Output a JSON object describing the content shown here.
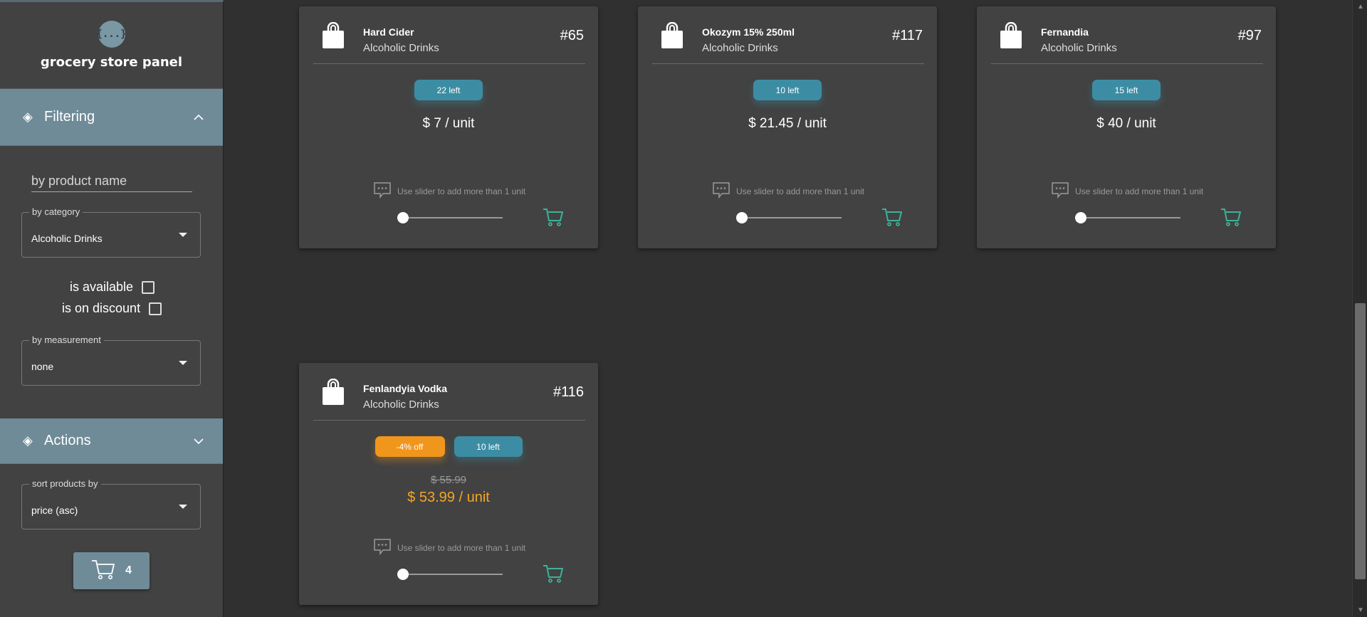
{
  "app": {
    "logo_glyph": "{...}",
    "title": "grocery store panel"
  },
  "sidebar": {
    "filtering": {
      "label": "Filtering",
      "expanded": true
    },
    "search": {
      "placeholder": "by product name",
      "value": ""
    },
    "category": {
      "legend": "by category",
      "value": "Alcoholic Drinks"
    },
    "is_available": {
      "label": "is available",
      "checked": false
    },
    "is_on_discount": {
      "label": "is on discount",
      "checked": false
    },
    "measurement": {
      "legend": "by measurement",
      "value": "none"
    },
    "actions": {
      "label": "Actions",
      "expanded": false
    },
    "sort": {
      "legend": "sort products by",
      "value": "price (asc)"
    },
    "cart": {
      "count": "4"
    }
  },
  "products": [
    {
      "name": "Hard Cider",
      "category": "Alcoholic Drinks",
      "id": "#65",
      "stock": "22 left",
      "price": "$ 7 / unit",
      "hint": "Use slider to add more than 1 unit"
    },
    {
      "name": "Okozym 15% 250ml",
      "category": "Alcoholic Drinks",
      "id": "#117",
      "stock": "10 left",
      "price": "$ 21.45 / unit",
      "hint": "Use slider to add more than 1 unit"
    },
    {
      "name": "Fernandia",
      "category": "Alcoholic Drinks",
      "id": "#97",
      "stock": "15 left",
      "price": "$ 40 / unit",
      "hint": "Use slider to add more than 1 unit"
    },
    {
      "name": "Fenlandyia Vodka",
      "category": "Alcoholic Drinks",
      "id": "#116",
      "discount": "-4% off",
      "stock": "10 left",
      "old_price": "$ 55.99",
      "new_price": "$ 53.99 / unit",
      "hint": "Use slider to add more than 1 unit"
    }
  ],
  "colors": {
    "accent": "#6f8b98",
    "stock_badge": "#3c8da3",
    "discount_badge": "#f0961c",
    "discount_price": "#f5a623",
    "cart_icon": "#3cb39a"
  },
  "icons": {
    "logo": "curly-braces-icon",
    "section": "diamond-icon",
    "product": "shopping-bag-icon",
    "hint": "message-dots-icon",
    "add": "cart-icon"
  }
}
